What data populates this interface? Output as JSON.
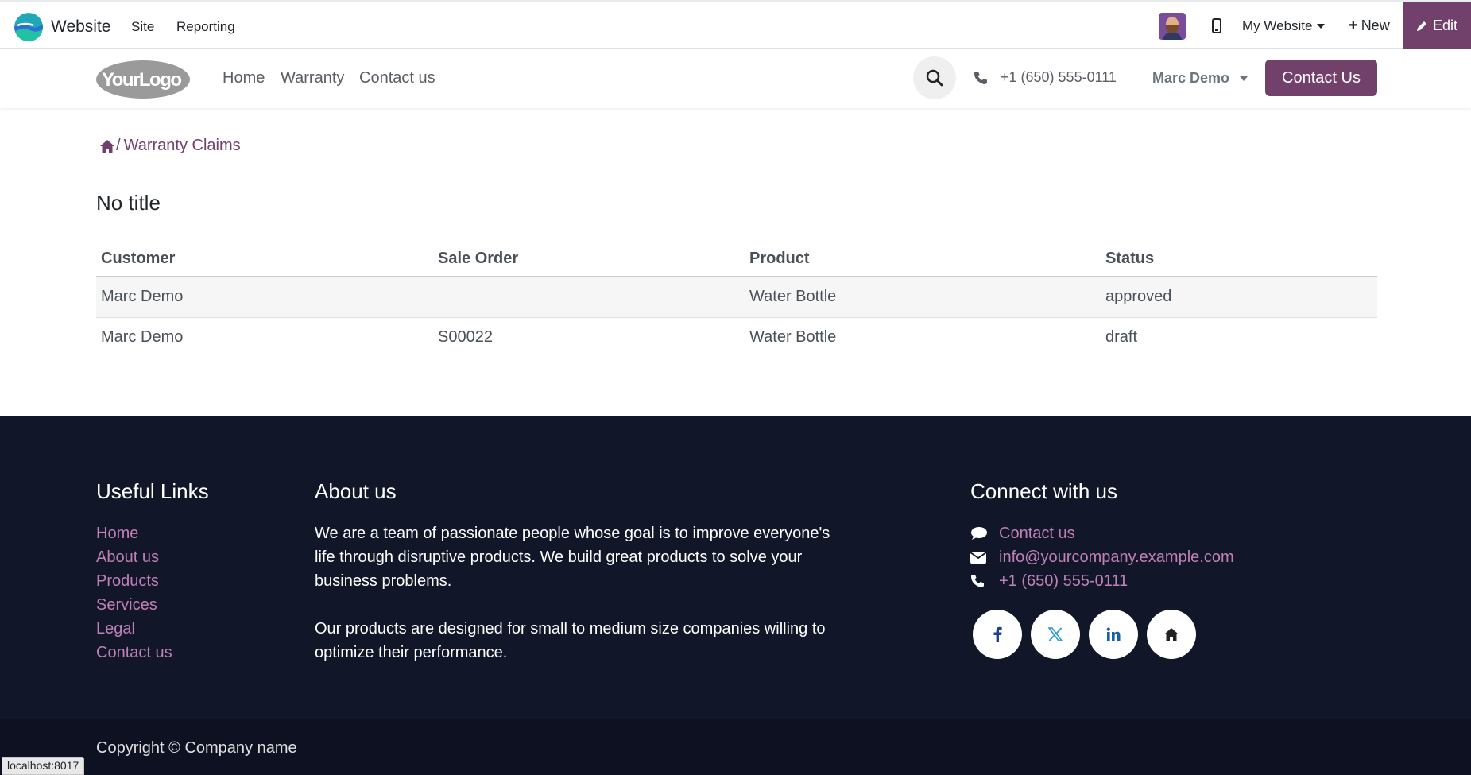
{
  "admin_bar": {
    "app_name": "Website",
    "menu": [
      "Site",
      "Reporting"
    ],
    "website_selector": "My Website",
    "new_label": "New",
    "edit_label": "Edit"
  },
  "header": {
    "logo_text": "YourLogo",
    "nav": [
      "Home",
      "Warranty",
      "Contact us"
    ],
    "phone": "+1 (650) 555-0111",
    "user": "Marc Demo",
    "cta": "Contact Us"
  },
  "breadcrumb": {
    "separator": "/",
    "current": "Warranty Claims"
  },
  "page_title": "No title",
  "table": {
    "headers": [
      "Customer",
      "Sale Order",
      "Product",
      "Status"
    ],
    "rows": [
      [
        "Marc Demo",
        "",
        "Water Bottle",
        "approved"
      ],
      [
        "Marc Demo",
        "S00022",
        "Water Bottle",
        "draft"
      ]
    ]
  },
  "footer": {
    "useful_links_title": "Useful Links",
    "useful_links": [
      "Home",
      "About us",
      "Products",
      "Services",
      "Legal",
      "Contact us"
    ],
    "about_title": "About us",
    "about_p1": "We are a team of passionate people whose goal is to improve everyone's life through disruptive products. We build great products to solve your business problems.",
    "about_p2": "Our products are designed for small to medium size companies willing to optimize their performance.",
    "connect_title": "Connect with us",
    "connect": [
      {
        "icon": "comment-icon",
        "label": "Contact us"
      },
      {
        "icon": "envelope-icon",
        "label": "info@yourcompany.example.com"
      },
      {
        "icon": "phone-icon",
        "label": "+1 (650) 555-0111"
      }
    ],
    "socials": [
      "facebook-icon",
      "x-twitter-icon",
      "linkedin-icon",
      "home-icon"
    ],
    "copyright": "Copyright © Company name"
  },
  "status_url": "localhost:8017",
  "colors": {
    "brand": "#71406b",
    "footer_bg": "#111629",
    "link_pink": "#c080b8"
  }
}
